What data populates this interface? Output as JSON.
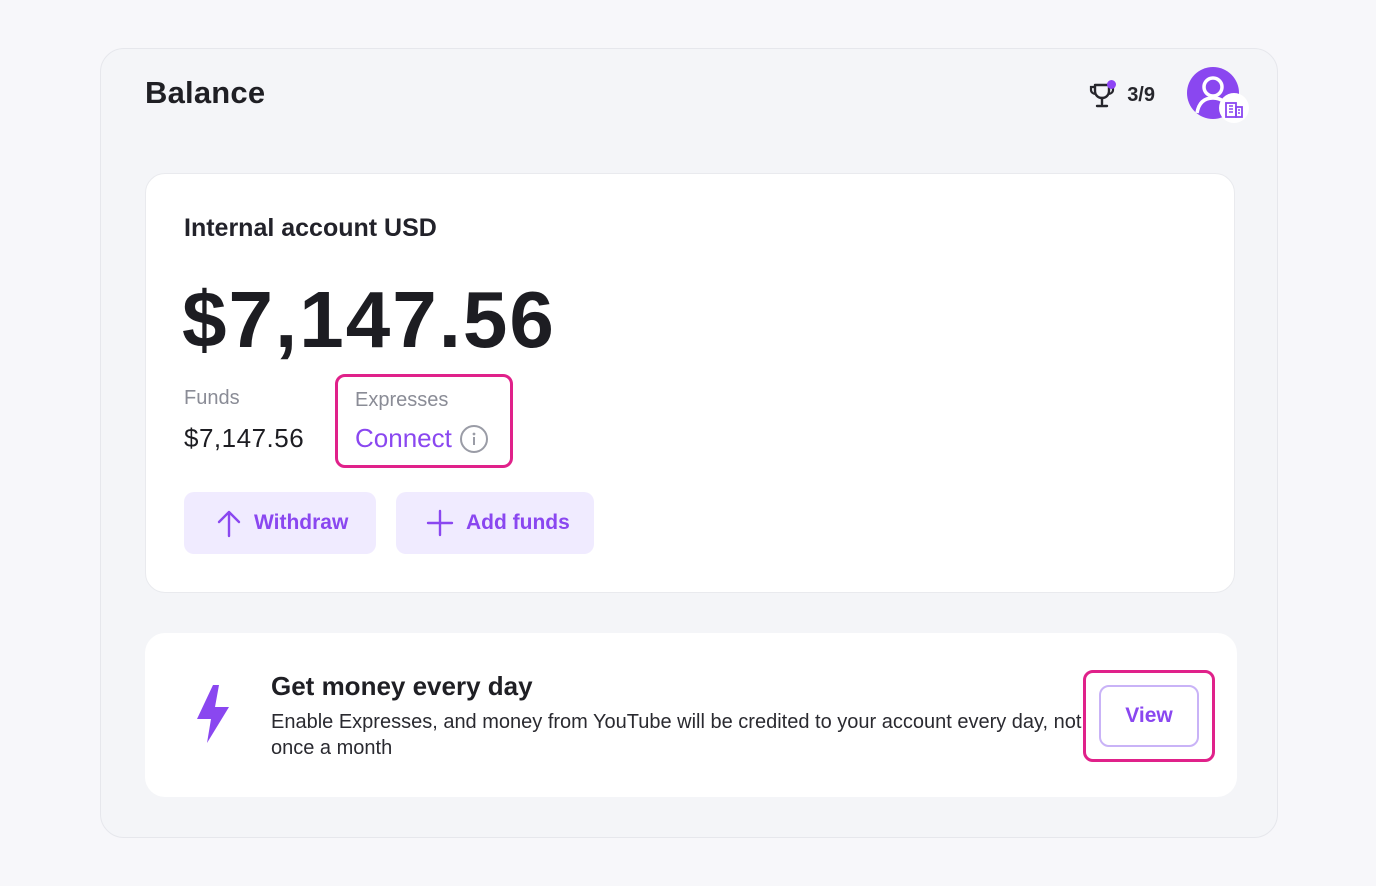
{
  "header": {
    "title": "Balance",
    "progress": "3/9",
    "trophy_icon": "trophy-icon",
    "avatar_icon": "user-building-icon"
  },
  "account": {
    "title": "Internal account USD",
    "balance": "$7,147.56",
    "funds_label": "Funds",
    "funds_value": "$7,147.56",
    "expresses_label": "Expresses",
    "connect_label": "Connect",
    "info_icon": "info-icon"
  },
  "actions": {
    "withdraw_label": "Withdraw",
    "add_funds_label": "Add funds"
  },
  "promo": {
    "icon": "lightning-icon",
    "title": "Get money every day",
    "description": "Enable Expresses, and money from YouTube will be credited to your account every day, not once a month",
    "view_label": "View"
  },
  "colors": {
    "accent": "#8a47f0",
    "accent_light": "#f0ebff",
    "highlight": "#e0218a",
    "background": "#f4f5f8"
  }
}
